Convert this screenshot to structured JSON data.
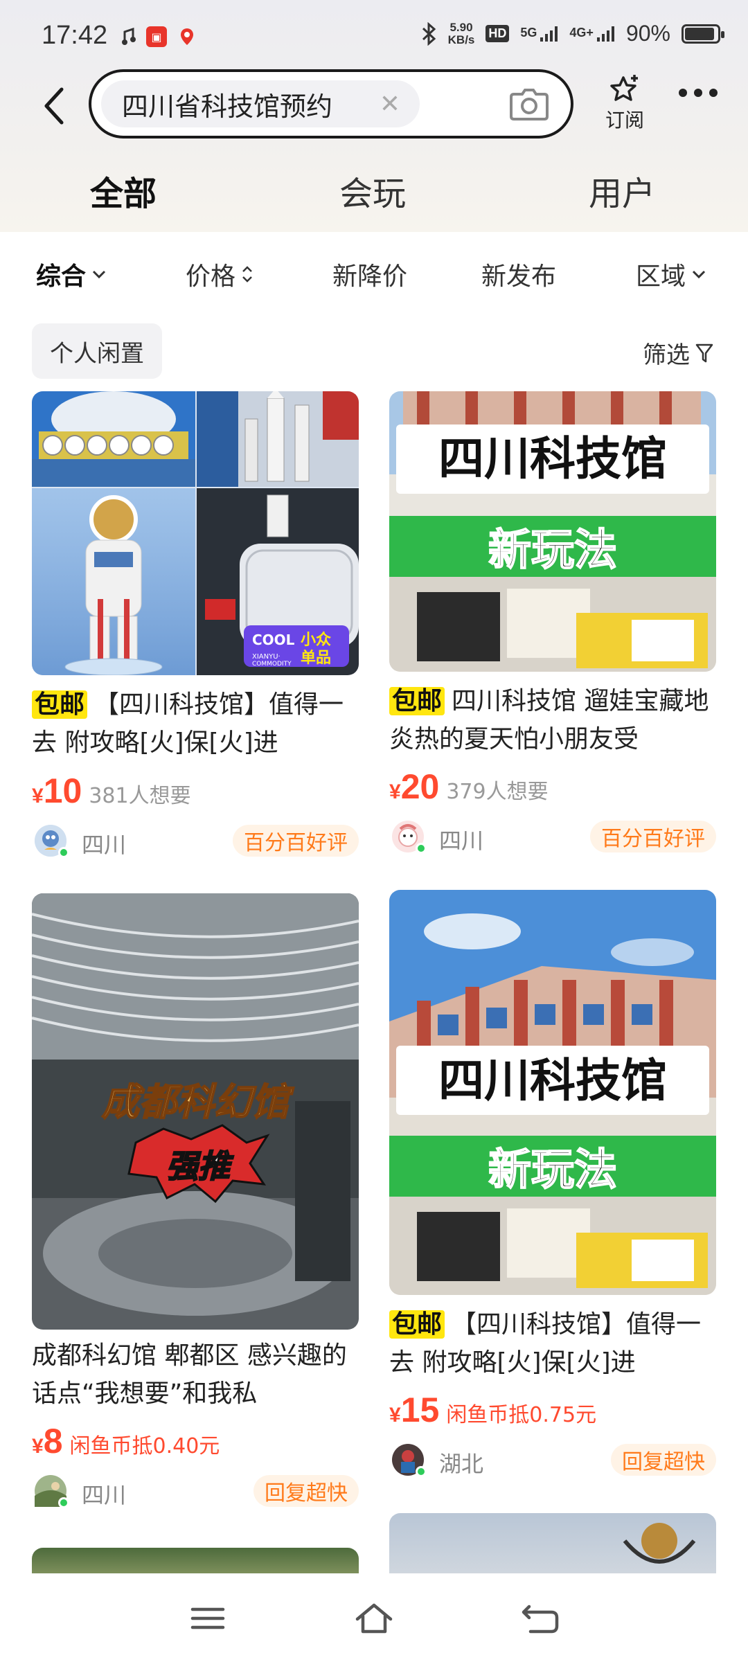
{
  "status_bar": {
    "time": "17:42",
    "speed_top": "5.90",
    "speed_unit": "KB/s",
    "hd": "HD",
    "net1": "5G",
    "net2": "4G+",
    "battery": "90%"
  },
  "search": {
    "query": "四川省科技馆预约",
    "subscribe_label": "订阅"
  },
  "tabs": [
    {
      "label": "全部",
      "active": true
    },
    {
      "label": "会玩",
      "active": false
    },
    {
      "label": "用户",
      "active": false
    }
  ],
  "sort": [
    {
      "label": "综合",
      "arrow": "⌄"
    },
    {
      "label": "价格",
      "arrow": "⇕"
    },
    {
      "label": "新降价",
      "arrow": ""
    },
    {
      "label": "新发布",
      "arrow": ""
    },
    {
      "label": "区域",
      "arrow": "⌄"
    }
  ],
  "filter": {
    "personal_chip": "个人闲置",
    "filter_label": "筛选"
  },
  "cards": [
    {
      "badge": "包邮",
      "title": "【四川科技馆】值得一去 附攻略[火]保[火]进",
      "currency": "¥",
      "price": "10",
      "extra": "381人想要",
      "region": "四川",
      "tag": "百分百好评",
      "image_overlay": "COOL XIANYU·COMMODITY 小众单品"
    },
    {
      "badge": "包邮",
      "title": "四川科技馆 遛娃宝藏地 炎热的夏天怕小朋友受",
      "currency": "¥",
      "price": "20",
      "extra": "379人想要",
      "region": "四川",
      "tag": "百分百好评",
      "image_overlay_1": "四川科技馆",
      "image_overlay_2": "新玩法"
    },
    {
      "badge": "",
      "title": "成都科幻馆  郫都区 感兴趣的话点“我想要”和我私",
      "currency": "¥",
      "price": "8",
      "extra": "闲鱼币抵0.40元",
      "region": "四川",
      "tag": "回复超快",
      "image_overlay_1": "成都科幻馆",
      "image_overlay_2": "强推"
    },
    {
      "badge": "包邮",
      "title": "【四川科技馆】值得一去 附攻略[火]保[火]进",
      "currency": "¥",
      "price": "15",
      "extra": "闲鱼币抵0.75元",
      "region": "湖北",
      "tag": "回复超快",
      "image_overlay_1": "四川科技馆",
      "image_overlay_2": "新玩法"
    }
  ],
  "colors": {
    "accent_yellow": "#ffe60f",
    "price_red": "#ff4a2f",
    "tag_orange": "#ff7a1a",
    "online_green": "#2ecc5a"
  },
  "icons": {
    "back": "back-arrow-icon",
    "camera": "camera-icon",
    "subscribe": "star-plus-icon",
    "more": "more-dots-icon",
    "filter": "filter-funnel-icon",
    "nav_menu": "menu-icon",
    "nav_home": "home-icon",
    "nav_back": "return-icon"
  }
}
